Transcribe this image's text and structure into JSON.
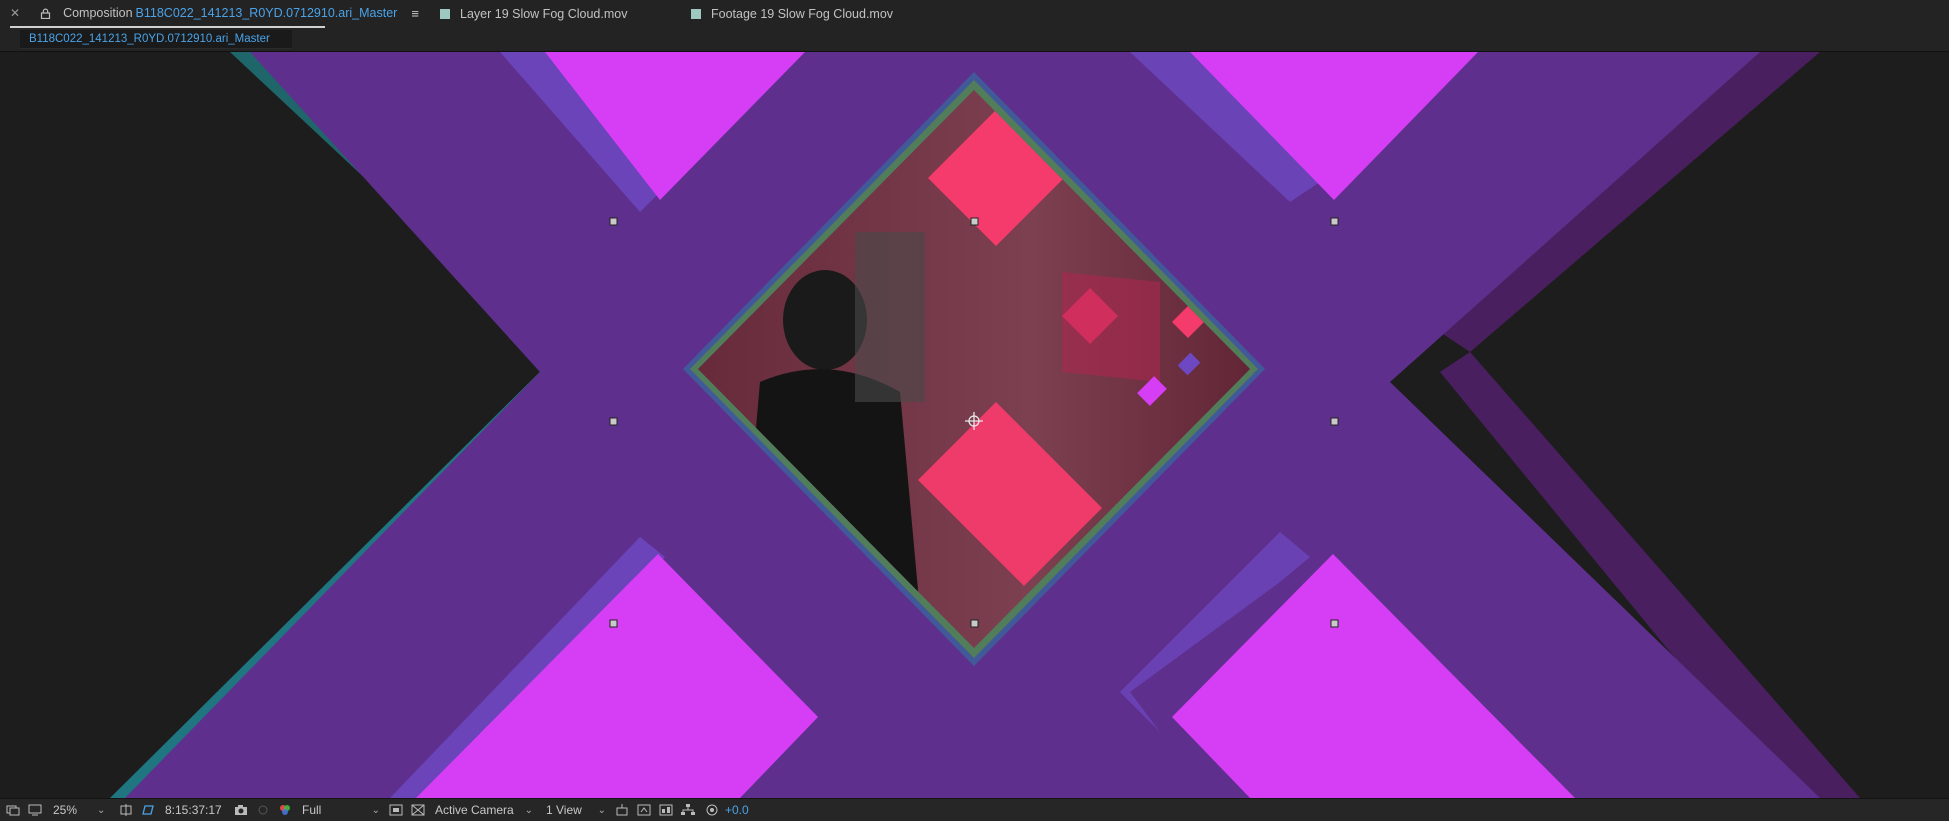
{
  "tabs": {
    "composition": {
      "prefix": "Composition",
      "name": "B118C022_141213_R0YD.0712910.ari_Master",
      "swatch_color": "#a89a7a"
    },
    "layer": {
      "label": "Layer 19 Slow Fog Cloud.mov",
      "swatch_color": "#9fc9c0"
    },
    "footage": {
      "label": "Footage 19 Slow Fog Cloud.mov",
      "swatch_color": "#9fc9c0"
    }
  },
  "breadcrumb": {
    "label": "B118C022_141213_R0YD.0712910.ari_Master"
  },
  "viewer": {
    "colors": {
      "background": "#1d1d1d",
      "purple_band": "#5f2f8e",
      "magenta": "#d63ef6",
      "pink": "#f53b6b",
      "teal_edge": "#2d7e86",
      "crimson": "#8a1d3a"
    }
  },
  "toolbar": {
    "magnification": "25%",
    "timecode": "8:15:37:17",
    "resolution": "Full",
    "camera": "Active Camera",
    "view_layout": "1 View",
    "exposure": "+0.0"
  },
  "icons": [
    "close-icon",
    "label-swatch-icon",
    "lock-icon",
    "menu-icon",
    "always-preview-icon",
    "monitor-icon",
    "chevron-down-icon",
    "roi-icon",
    "transparency-grid-icon",
    "snapshot-icon",
    "show-snapshot-icon",
    "channel-icon",
    "fast-preview-icon",
    "toggle-mask-icon",
    "draft3d-icon",
    "flowchart-icon",
    "exposure-icon",
    "anchor-point-icon",
    "handle-icon"
  ]
}
